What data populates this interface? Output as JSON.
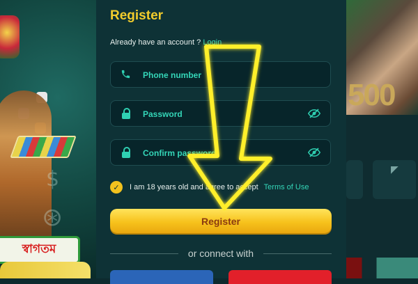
{
  "register": {
    "title": "Register",
    "account_prompt": "Already have an account ?",
    "login_link": "Login",
    "phone_placeholder": "Phone number",
    "password_placeholder": "Password",
    "confirm_placeholder": "Confirm password",
    "terms_text": "I am 18 years old and agree to accept",
    "terms_link": "Terms of Use",
    "submit_label": "Register",
    "divider_text": "or connect with"
  },
  "promo": {
    "welcome_text": "স্বাগতম"
  },
  "icons": {
    "phone": "phone-icon",
    "lock": "lock-icon",
    "eye_off": "eye-off-icon",
    "check": "checkmark-icon",
    "annotation": "arrow-down-annotation"
  },
  "colors": {
    "accent_yellow": "#f2cc2c",
    "accent_teal": "#34d6b8",
    "panel_bg": "#0e3236",
    "field_bg": "#07252a",
    "arrow": "#ffef2a"
  }
}
